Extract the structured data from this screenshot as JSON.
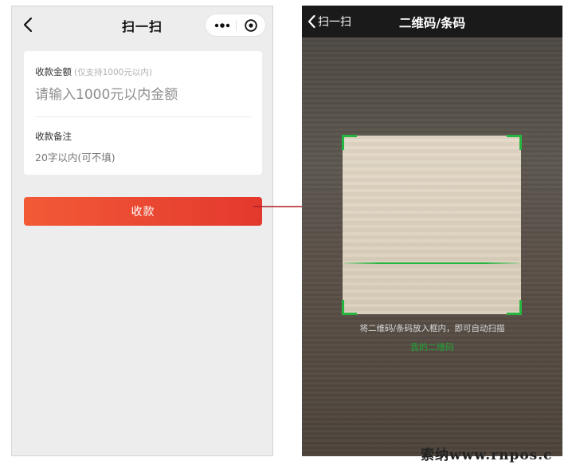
{
  "left_screen": {
    "nav": {
      "title": "扫一扫",
      "icons": [
        "chevron-left-icon",
        "more-dots-icon",
        "target-close-icon"
      ]
    },
    "amount": {
      "label": "收款金额",
      "hint": "(仅支持1000元以内)",
      "placeholder": "请输入1000元以内金额"
    },
    "note": {
      "label": "收款备注",
      "placeholder": "20字以内(可不填)"
    },
    "pay_button": {
      "label": "收款"
    },
    "colors": {
      "accent": "#ea4630",
      "background": "#ededed"
    }
  },
  "right_screen": {
    "nav": {
      "back_label": "扫一扫",
      "title": "二维码/条码"
    },
    "scan_hint": "将二维码/条码放入框内，即可自动扫描",
    "my_qr_link": "我的二维码",
    "colors": {
      "scan_green": "#26b53f",
      "nav_bg": "#1a1a1a"
    }
  },
  "watermark": "索纳www.rnpos.c"
}
